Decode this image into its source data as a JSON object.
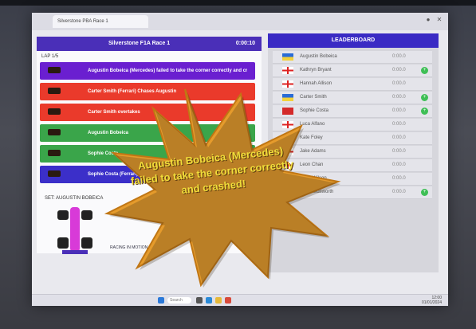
{
  "browser": {
    "tab_title": "Silverstone PBA Race 1",
    "close_glyph": "✕"
  },
  "race": {
    "title": "Silverstone F1A Race 1",
    "timer": "0:00:10",
    "laps": "LAP 1/5",
    "rows": [
      {
        "text": "Augustin Bobeica (Mercedes) failed to take the corner correctly and crashed",
        "color": "#6a1fd0"
      },
      {
        "text": "Carter Smith (Ferrari) Chases Augustin",
        "color": "#ea3a2b"
      },
      {
        "text": "Carter Smith overtakes",
        "color": "#ea3a2b"
      },
      {
        "text": "Augustin Bobeica",
        "color": "#3aa54a"
      },
      {
        "text": "Sophie Costa",
        "color": "#3aa54a"
      },
      {
        "text": "Sophie Costa (Ferrari)",
        "color": "#3b2fc9"
      }
    ],
    "tracking": "SET: AUGUSTIN BOBEICA",
    "brand": "RACING IN MOTION"
  },
  "leaderboard": {
    "title": "LEADERBOARD",
    "rows": [
      {
        "name": "Augustin Bobeica",
        "time": "0:00.0",
        "flag": "ukraine",
        "dot": ""
      },
      {
        "name": "Kathryn Bryant",
        "time": "0:00.0",
        "flag": "england",
        "dot": "+"
      },
      {
        "name": "Hannah Allison",
        "time": "0:00.0",
        "flag": "england",
        "dot": ""
      },
      {
        "name": "Carter Smith",
        "time": "0:00.0",
        "flag": "ukraine",
        "dot": "+"
      },
      {
        "name": "Sophie Costa",
        "time": "0:00.0",
        "flag": "red",
        "dot": "+"
      },
      {
        "name": "Luca Alfano",
        "time": "0:00.0",
        "flag": "england",
        "dot": ""
      },
      {
        "name": "Kate Foley",
        "time": "0:00.0",
        "flag": "red",
        "dot": ""
      },
      {
        "name": "Jake Adams",
        "time": "0:00.0",
        "flag": "england",
        "dot": ""
      },
      {
        "name": "Leon Chan",
        "time": "0:00.0",
        "flag": "england",
        "dot": ""
      },
      {
        "name": "Willis Wilson",
        "time": "0:00.0",
        "flag": "england",
        "dot": ""
      },
      {
        "name": "Sue Holdsworth",
        "time": "0:00.0",
        "flag": "england",
        "dot": "+"
      }
    ]
  },
  "overlay": {
    "line1": "Augustin Bobeica (Mercedes)",
    "line2": "failed to take the corner correctly",
    "line3": "and crashed!"
  },
  "taskbar": {
    "search": "Search",
    "time": "12:00",
    "date": "01/01/2024"
  },
  "colors": {
    "purple": "#6a1fd0",
    "red": "#ea3a2b",
    "green": "#3aa54a",
    "blue": "#3b2fc9",
    "burst": "#e59b2c",
    "burst_text": "#f1dd3a"
  }
}
